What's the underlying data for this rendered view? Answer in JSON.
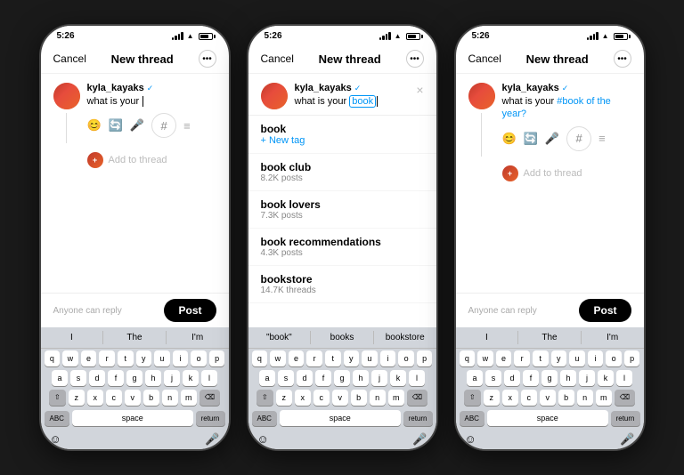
{
  "phones": [
    {
      "id": "phone1",
      "statusBar": {
        "time": "5:26",
        "timeLabel": "5:26"
      },
      "nav": {
        "cancel": "Cancel",
        "title": "New thread",
        "more": "···"
      },
      "post": {
        "username": "kyla_kayaks",
        "verified": true,
        "text": "what is your ",
        "textCursor": true,
        "hashtag": ""
      },
      "toolbar": {
        "icons": [
          "😊",
          "🔄",
          "🎤",
          "#",
          "≡"
        ]
      },
      "addToThread": "Add to thread",
      "bottomBar": {
        "replyText": "Anyone can reply",
        "postLabel": "Post"
      },
      "keyboard": {
        "suggestions": [
          "I",
          "The",
          "I'm"
        ],
        "rows": [
          [
            "q",
            "w",
            "e",
            "r",
            "t",
            "y",
            "u",
            "i",
            "o",
            "p"
          ],
          [
            "a",
            "s",
            "d",
            "f",
            "g",
            "h",
            "j",
            "k",
            "l"
          ],
          [
            "z",
            "x",
            "c",
            "v",
            "b",
            "n",
            "m"
          ]
        ],
        "bottomLeft": "ABC",
        "space": "space",
        "return": "return"
      }
    },
    {
      "id": "phone2",
      "statusBar": {
        "time": "5:26"
      },
      "nav": {
        "cancel": "Cancel",
        "title": "New thread",
        "more": "···"
      },
      "post": {
        "username": "kyla_kayaks",
        "verified": true,
        "text": "what is your book",
        "textCursor": true,
        "hashtag": ""
      },
      "suggestions": [
        {
          "main": "book",
          "sub": "+ New tag",
          "isNewTag": true
        },
        {
          "main": "book club",
          "sub": "8.2K posts"
        },
        {
          "main": "book lovers",
          "sub": "7.3K posts"
        },
        {
          "main": "book recommendations",
          "sub": "4.3K posts"
        },
        {
          "main": "bookstore",
          "sub": "14.7K threads"
        }
      ],
      "keyboard": {
        "suggestions": [
          "\"book\"",
          "books",
          "bookstore"
        ],
        "rows": [
          [
            "q",
            "w",
            "e",
            "r",
            "t",
            "y",
            "u",
            "i",
            "o",
            "p"
          ],
          [
            "a",
            "s",
            "d",
            "f",
            "g",
            "h",
            "j",
            "k",
            "l"
          ],
          [
            "z",
            "x",
            "c",
            "v",
            "b",
            "n",
            "m"
          ]
        ],
        "bottomLeft": "ABC",
        "space": "space",
        "return": "return"
      }
    },
    {
      "id": "phone3",
      "statusBar": {
        "time": "5:26"
      },
      "nav": {
        "cancel": "Cancel",
        "title": "New thread",
        "more": "···"
      },
      "post": {
        "username": "kyla_kayaks",
        "verified": true,
        "textBefore": "what is your ",
        "hashtag": "book of the year?",
        "textCursor": false
      },
      "toolbar": {
        "icons": [
          "😊",
          "🔄",
          "🎤",
          "#",
          "≡"
        ]
      },
      "addToThread": "Add to thread",
      "bottomBar": {
        "replyText": "Anyone can reply",
        "postLabel": "Post"
      },
      "keyboard": {
        "suggestions": [
          "I",
          "The",
          "I'm"
        ],
        "rows": [
          [
            "q",
            "w",
            "e",
            "r",
            "t",
            "y",
            "u",
            "i",
            "o",
            "p"
          ],
          [
            "a",
            "s",
            "d",
            "f",
            "g",
            "h",
            "j",
            "k",
            "l"
          ],
          [
            "z",
            "x",
            "c",
            "v",
            "b",
            "n",
            "m"
          ]
        ],
        "bottomLeft": "ABC",
        "space": "space",
        "return": "return"
      }
    }
  ],
  "colors": {
    "background": "#1a1a1a",
    "phoneBackground": "#ffffff",
    "accent": "#0095f6",
    "postButton": "#000000",
    "hashtagColor": "#0095f6"
  }
}
